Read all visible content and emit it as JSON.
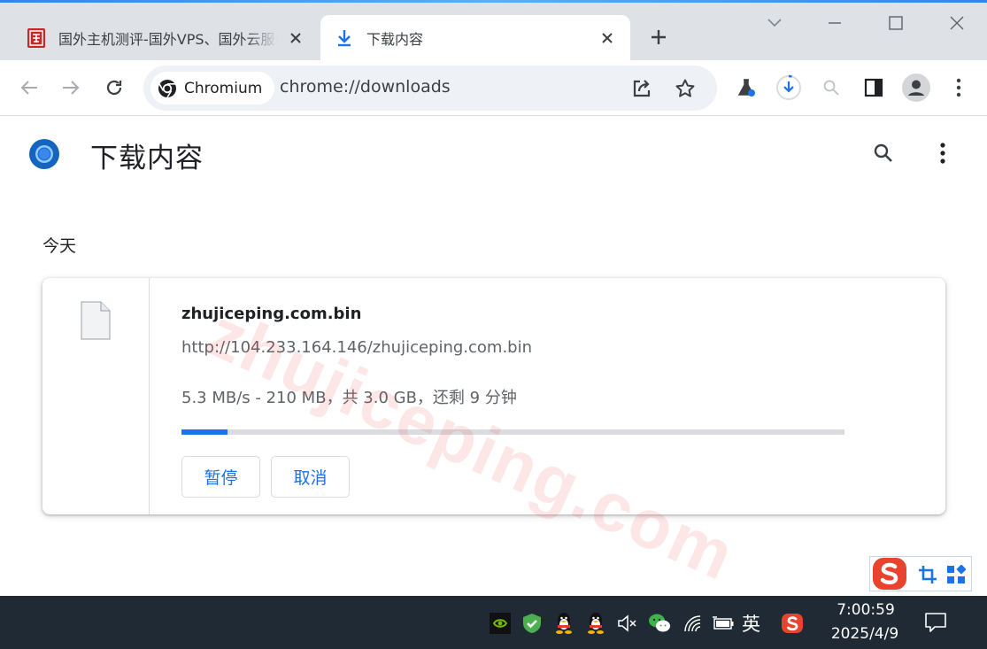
{
  "tabs": [
    {
      "title": "国外主机测评-国外VPS、国外云服务器",
      "favicon": "site-seal-icon"
    },
    {
      "title": "下载内容",
      "favicon": "download-icon"
    }
  ],
  "toolbar": {
    "chip_label": "Chromium",
    "url": "chrome://downloads"
  },
  "page": {
    "title": "下载内容",
    "section_date": "今天"
  },
  "download": {
    "file_name": "zhujiceping.com.bin",
    "url": "http://104.233.164.146/zhujiceping.com.bin",
    "status": "5.3 MB/s - 210 MB，共 3.0 GB，还剩 9 分钟",
    "progress_fraction": 0.07,
    "pause_label": "暂停",
    "cancel_label": "取消"
  },
  "watermark": "zhujiceping.com",
  "taskbar": {
    "ime_language": "英",
    "time": "7:00:59",
    "date": "2025/4/9"
  },
  "colors": {
    "accent": "#1a73e8",
    "tabstrip": "#dee1e6",
    "taskbar": "#1f2a35",
    "sogou": "#e8442d"
  }
}
